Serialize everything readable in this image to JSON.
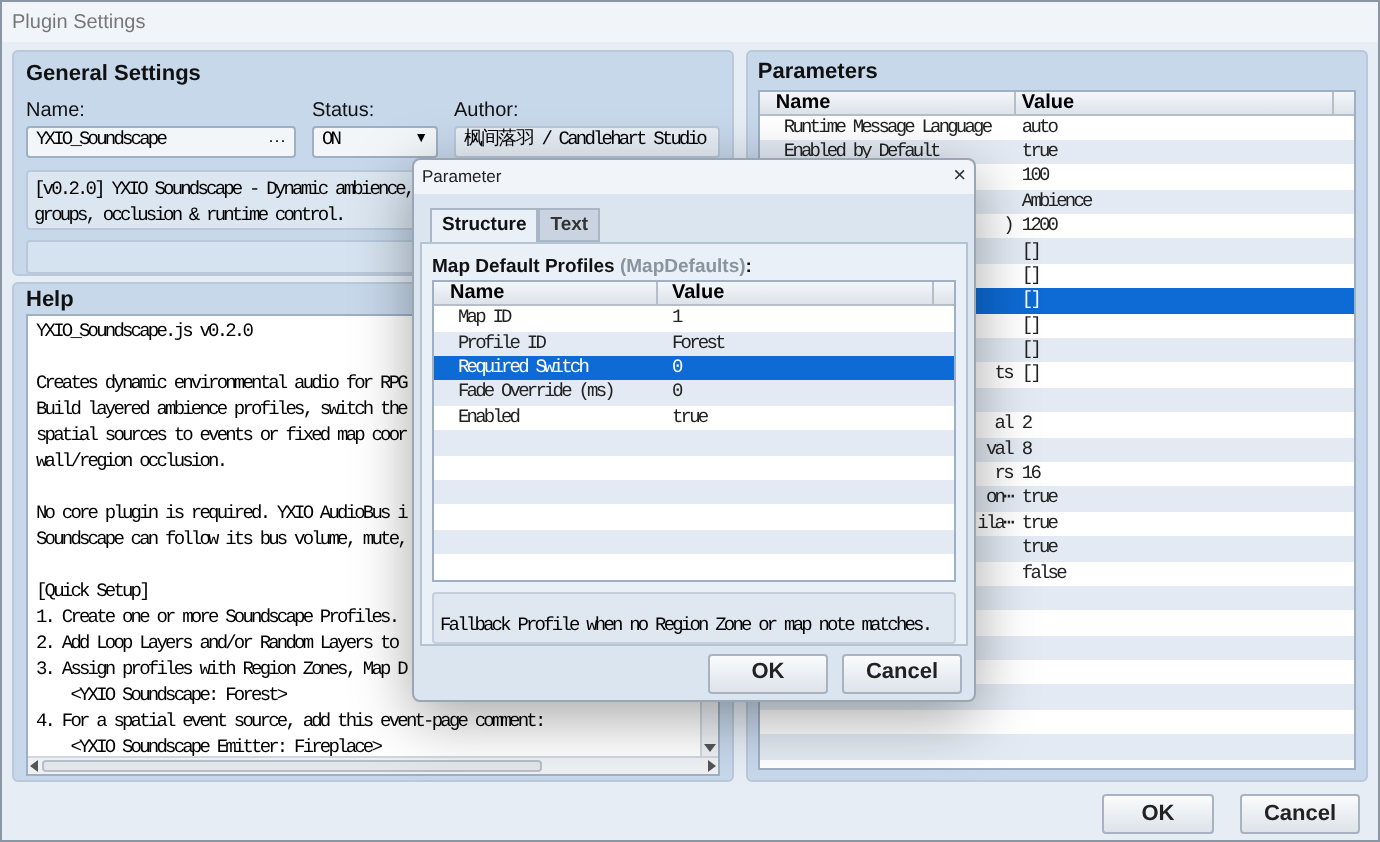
{
  "window": {
    "title": "Plugin Settings"
  },
  "general": {
    "heading": "General Settings",
    "name_label": "Name:",
    "name_value": "YXIO_Soundscape",
    "name_button": "···",
    "status_label": "Status:",
    "status_value": "ON",
    "status_arrow": "▼",
    "author_label": "Author:",
    "author_value": "枫间落羽 / Candlehart Studio",
    "description": [
      "[v0.2.0] YXIO Soundscape - Dynamic ambience,",
      "groups, occlusion & runtime control."
    ]
  },
  "help": {
    "heading": "Help",
    "paragraphs": [
      [
        "YXIO_Soundscape.js v0.2.0"
      ],
      [
        "Creates dynamic environmental audio for RPG",
        "Build layered ambience profiles, switch the",
        "spatial sources to events or fixed map coor",
        "wall/region occlusion."
      ],
      [
        "No core plugin is required. YXIO AudioBus i",
        "Soundscape can follow its bus volume, mute,"
      ],
      [
        "[Quick Setup]",
        "1. Create one or more Soundscape Profiles.",
        "2. Add Loop Layers and/or Random Layers to",
        "3. Assign profiles with Region Zones, Map D",
        "    <YXIO Soundscape: Forest>",
        "4. For a spatial event source, add this event-page comment:",
        "    <YXIO Soundscape Emitter: Fireplace>"
      ]
    ]
  },
  "parameters": {
    "heading": "Parameters",
    "columns": [
      "Name",
      "Value"
    ],
    "rows": [
      {
        "kind": "full",
        "name": "Runtime Message Language",
        "value": "auto",
        "selected": false
      },
      {
        "kind": "full",
        "name": "Enabled by Default",
        "value": "true",
        "selected": false
      },
      {
        "kind": "hidden",
        "value": "100",
        "selected": false
      },
      {
        "kind": "hidden",
        "value": "Ambience",
        "selected": false
      },
      {
        "kind": "partial",
        "name": ")",
        "value": "1200",
        "selected": false
      },
      {
        "kind": "hidden",
        "value": "[]",
        "selected": false
      },
      {
        "kind": "hidden",
        "value": "[]",
        "selected": false
      },
      {
        "kind": "hidden",
        "value": "[]",
        "selected": true
      },
      {
        "kind": "hidden",
        "value": "[]",
        "selected": false
      },
      {
        "kind": "hidden",
        "value": "[]",
        "selected": false
      },
      {
        "kind": "partial",
        "name": "ts",
        "value": "[]",
        "selected": false
      },
      {
        "kind": "hidden",
        "selected": false
      },
      {
        "kind": "partial",
        "name": "al",
        "value": "2",
        "selected": false
      },
      {
        "kind": "partial",
        "name": "val",
        "value": "8",
        "selected": false
      },
      {
        "kind": "partial",
        "name": "rs",
        "value": "16",
        "selected": false
      },
      {
        "kind": "partial",
        "name": "on⋯",
        "value": "true",
        "selected": false
      },
      {
        "kind": "partial",
        "name": "ila⋯",
        "value": "true",
        "selected": false
      },
      {
        "kind": "hidden",
        "value": "true",
        "selected": false
      },
      {
        "kind": "hidden",
        "value": "false",
        "selected": false
      }
    ]
  },
  "buttons": [
    "OK",
    "Cancel"
  ],
  "dialog": {
    "title": "Parameter",
    "close": "×",
    "tabs": [
      {
        "label": "Structure",
        "selected": true
      },
      {
        "label": "Text",
        "selected": false
      }
    ],
    "label": "Map Default Profiles",
    "key": "(MapDefaults)",
    "suffix": ":",
    "columns": [
      "Name",
      "Value"
    ],
    "rows": [
      {
        "name": "Map ID",
        "value": "1",
        "selected": false
      },
      {
        "name": "Profile ID",
        "value": "Forest",
        "selected": false
      },
      {
        "name": "Required Switch",
        "value": "0",
        "selected": true
      },
      {
        "name": "Fade Override (ms)",
        "value": "0",
        "selected": false
      },
      {
        "name": "Enabled",
        "value": "true",
        "selected": false
      }
    ],
    "description": "Fallback Profile when no Region Zone or map note matches.",
    "buttons": [
      "OK",
      "Cancel"
    ]
  }
}
